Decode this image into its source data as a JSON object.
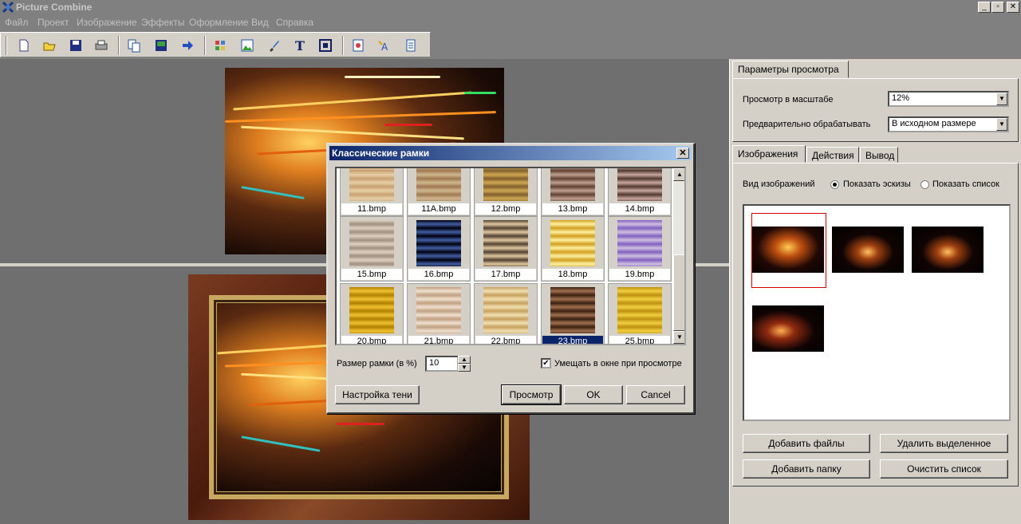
{
  "window": {
    "title": "Picture Combine",
    "icon": "app-logo-icon",
    "buttons": [
      "_",
      "▫",
      "✕"
    ]
  },
  "menu": [
    "Файл",
    "Проект",
    "Изображение",
    "Эффекты",
    "Оформление",
    "Вид",
    "Справка"
  ],
  "toolbar_icons": [
    "new-icon",
    "open-icon",
    "save-icon",
    "print-icon",
    "copy-icon",
    "save-image-icon",
    "arrow-icon",
    "layout-icon",
    "image-icon",
    "brush-icon",
    "text-icon",
    "frame-icon",
    "effect-icon",
    "font-icon",
    "page-icon"
  ],
  "right_panel": {
    "top_tab": "Параметры просмотра",
    "zoom_label": "Просмотр в масштабе",
    "zoom_value": "12%",
    "preprocess_label": "Предварительно обрабатывать",
    "preprocess_value": "В исходном размере",
    "tabs": [
      "Изображения",
      "Действия",
      "Вывод"
    ],
    "view_label": "Вид изображений",
    "view_thumbs": "Показать эскизы",
    "view_list": "Показать список",
    "buttons": {
      "add_files": "Добавить файлы",
      "delete_selected": "Удалить выделенное",
      "add_folder": "Добавить папку",
      "clear_list": "Очистить список"
    }
  },
  "dialog": {
    "title": "Классические рамки",
    "close": "✕",
    "frames": [
      {
        "name": "11.bmp",
        "c1": "#c8a070",
        "c2": "#e8d0a8"
      },
      {
        "name": "11A.bmp",
        "c1": "#a07850",
        "c2": "#d0b890"
      },
      {
        "name": "12.bmp",
        "c1": "#806030",
        "c2": "#d0a850"
      },
      {
        "name": "13.bmp",
        "c1": "#604030",
        "c2": "#c0a090"
      },
      {
        "name": "14.bmp",
        "c1": "#503830",
        "c2": "#c8a8a0"
      },
      {
        "name": "15.bmp",
        "c1": "#e0d0c0",
        "c2": "#a09080"
      },
      {
        "name": "16.bmp",
        "c1": "#000010",
        "c2": "#4060a0"
      },
      {
        "name": "17.bmp",
        "c1": "#504030",
        "c2": "#e0c8a0"
      },
      {
        "name": "18.bmp",
        "c1": "#d0a020",
        "c2": "#fff0a0"
      },
      {
        "name": "19.bmp",
        "c1": "#8060c0",
        "c2": "#d0c0e0"
      },
      {
        "name": "20.bmp",
        "c1": "#b08000",
        "c2": "#f0c030"
      },
      {
        "name": "21.bmp",
        "c1": "#c0a080",
        "c2": "#f0e0d0"
      },
      {
        "name": "22.bmp",
        "c1": "#c8a060",
        "c2": "#f0e0b0"
      },
      {
        "name": "23.bmp",
        "c1": "#3a2010",
        "c2": "#a07050"
      },
      {
        "name": "25.bmp",
        "c1": "#c09010",
        "c2": "#f0d040"
      }
    ],
    "selected_frame": "23.bmp",
    "size_label": "Размер рамки (в %)",
    "size_value": "10",
    "fit_label": "Умещать в окне при просмотре",
    "fit_checked": "✔",
    "shadow_btn": "Настройка тени",
    "preview_btn": "Просмотр",
    "ok_btn": "OK",
    "cancel_btn": "Cancel"
  }
}
